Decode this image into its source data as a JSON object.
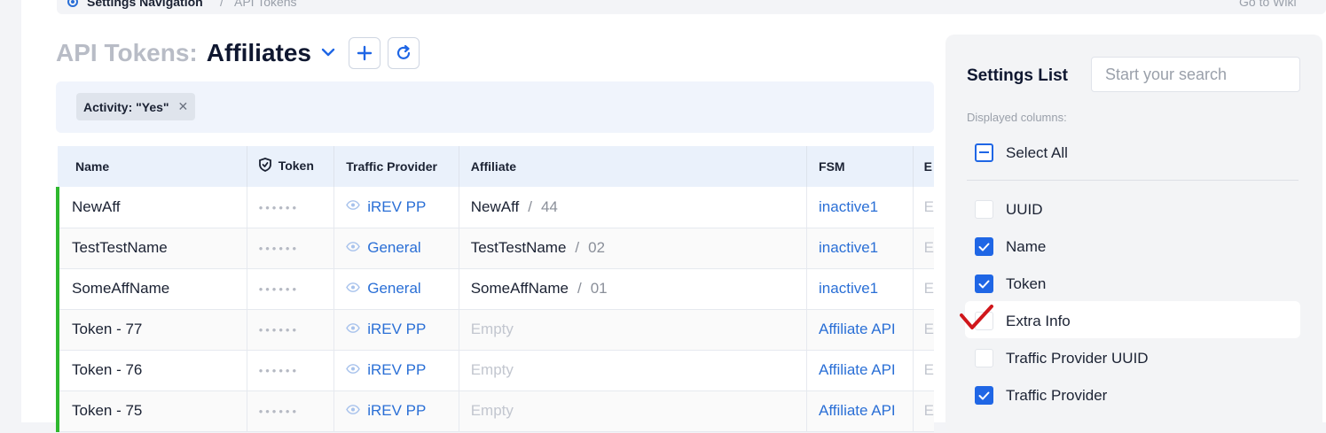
{
  "breadcrumb": {
    "root": "Settings Navigation",
    "separator": "/",
    "current": "API Tokens",
    "wiki": "Go to Wiki"
  },
  "page": {
    "title_prefix": "API Tokens:",
    "title_main": "Affiliates"
  },
  "filters": {
    "chip_label": "Activity: \"Yes\""
  },
  "table": {
    "headers": {
      "name": "Name",
      "token": "Token",
      "traffic_provider": "Traffic Provider",
      "affiliate": "Affiliate",
      "fsm": "FSM",
      "next": "E"
    },
    "rows": [
      {
        "name": "NewAff",
        "token": "••••••",
        "traffic_provider": "iREV PP",
        "affiliate": "NewAff",
        "affiliate_id": "44",
        "fsm": "inactive1",
        "next": "E"
      },
      {
        "name": "TestTestName",
        "token": "••••••",
        "traffic_provider": "General",
        "affiliate": "TestTestName",
        "affiliate_id": "02",
        "fsm": "inactive1",
        "next": "E"
      },
      {
        "name": "SomeAffName",
        "token": "••••••",
        "traffic_provider": "General",
        "affiliate": "SomeAffName",
        "affiliate_id": "01",
        "fsm": "inactive1",
        "next": "E"
      },
      {
        "name": "Token - 77",
        "token": "••••••",
        "traffic_provider": "iREV PP",
        "affiliate": "Empty",
        "affiliate_id": "",
        "fsm": "Affiliate API",
        "next": "E"
      },
      {
        "name": "Token - 76",
        "token": "••••••",
        "traffic_provider": "iREV PP",
        "affiliate": "Empty",
        "affiliate_id": "",
        "fsm": "Affiliate API",
        "next": "E"
      },
      {
        "name": "Token - 75",
        "token": "••••••",
        "traffic_provider": "iREV PP",
        "affiliate": "Empty",
        "affiliate_id": "",
        "fsm": "Affiliate API",
        "next": "E"
      }
    ]
  },
  "settings": {
    "title": "Settings List",
    "search_placeholder": "Start your search",
    "subtitle": "Displayed columns:",
    "select_all": "Select All",
    "options": [
      {
        "label": "UUID",
        "checked": false
      },
      {
        "label": "Name",
        "checked": true
      },
      {
        "label": "Token",
        "checked": true
      },
      {
        "label": "Extra Info",
        "checked": false
      },
      {
        "label": "Traffic Provider UUID",
        "checked": false
      },
      {
        "label": "Traffic Provider",
        "checked": true
      }
    ]
  },
  "colors": {
    "accent": "#1f66e5",
    "link": "#2a6fd6",
    "active_row": "#2eb82e",
    "annotation": "#d0161b"
  },
  "icons": [
    "settings-icon",
    "chevron-down-icon",
    "plus-icon",
    "refresh-icon",
    "close-icon",
    "shield-icon",
    "eye-icon",
    "checkmark-icon",
    "minus-icon"
  ]
}
